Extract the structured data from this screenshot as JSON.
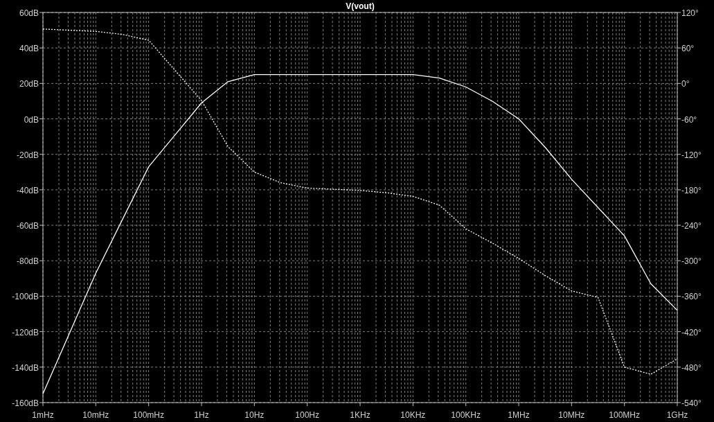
{
  "chart_data": {
    "type": "line",
    "title": "V(vout)",
    "grid": true,
    "categories": [
      "1mHz",
      null,
      "10mHz",
      null,
      "100mHz",
      null,
      "1Hz",
      null,
      "10Hz",
      null,
      "100Hz",
      null,
      "1KHz",
      null,
      "10KHz",
      null,
      "100KHz",
      null,
      "1MHz",
      null,
      "10MHz",
      null,
      "100MHz",
      null,
      "1GHz"
    ],
    "series": [
      {
        "color": "#ffffff",
        "values": [
          -155,
          -121,
          -87,
          -57,
          -27,
          -9,
          9,
          21,
          25,
          25,
          25,
          25,
          25,
          25,
          25,
          23,
          18,
          10,
          0,
          -16,
          -34,
          -50,
          -66,
          -93,
          -108
        ]
      },
      {
        "color": "#ffffff",
        "axis": "y2",
        "line_style": "dotted",
        "values": [
          92,
          90,
          88,
          83,
          73,
          22,
          -29,
          -107,
          -150,
          -168,
          -177,
          -179,
          -181,
          -185,
          -191,
          -206,
          -246,
          -270,
          -296,
          -325,
          -351,
          -362,
          -480,
          -492,
          -466
        ]
      }
    ],
    "ylim": [
      -160,
      60
    ],
    "y2lim": [
      -540,
      120
    ],
    "yticks": [
      {
        "value": 60,
        "label": "60dB"
      },
      {
        "value": 40,
        "label": "40dB"
      },
      {
        "value": 20,
        "label": "20dB"
      },
      {
        "value": 0,
        "label": "0dB"
      },
      {
        "value": -20,
        "label": "-20dB"
      },
      {
        "value": -40,
        "label": "-40dB"
      },
      {
        "value": -60,
        "label": "-60dB"
      },
      {
        "value": -80,
        "label": "-80dB"
      },
      {
        "value": -100,
        "label": "-100dB"
      },
      {
        "value": -120,
        "label": "-120dB"
      },
      {
        "value": -140,
        "label": "-140dB"
      },
      {
        "value": -160,
        "label": "-160dB"
      }
    ],
    "y2ticks": [
      {
        "value": 120,
        "label": "120°"
      },
      {
        "value": 60,
        "label": "60°"
      },
      {
        "value": 0,
        "label": "0°"
      },
      {
        "value": -60,
        "label": "-60°"
      },
      {
        "value": -120,
        "label": "-120°"
      },
      {
        "value": -180,
        "label": "-180°"
      },
      {
        "value": -240,
        "label": "-240°"
      },
      {
        "value": -300,
        "label": "-300°"
      },
      {
        "value": -360,
        "label": "-360°"
      },
      {
        "value": -420,
        "label": "-420°"
      },
      {
        "value": -480,
        "label": "-480°"
      },
      {
        "value": -540,
        "label": "-540°"
      }
    ]
  }
}
